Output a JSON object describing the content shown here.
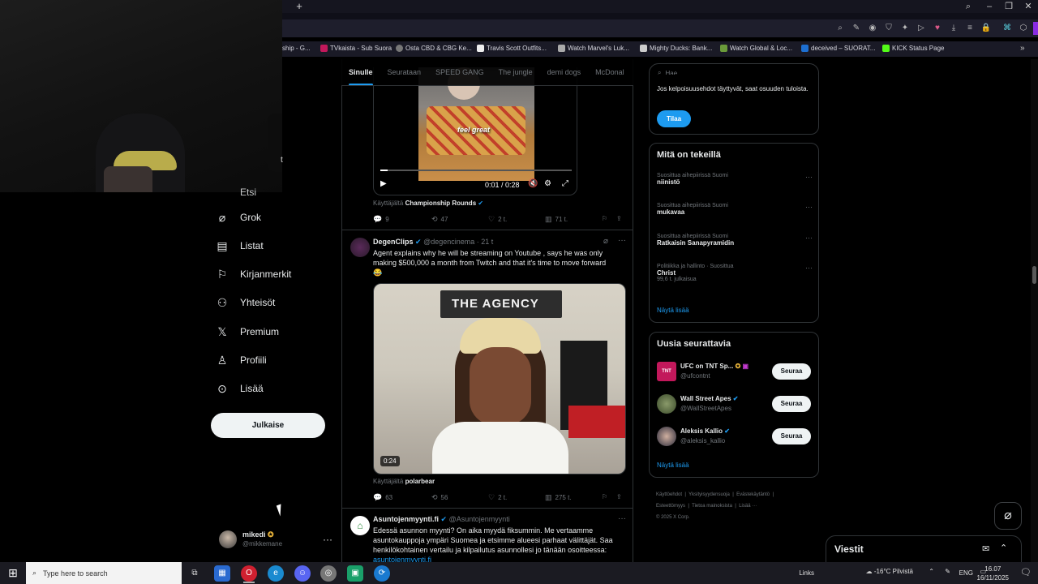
{
  "browser": {
    "bookmarks": [
      "ship - G...",
      "TVkaista - Sub Suora",
      "Osta CBD & CBG Ke...",
      "Travis Scott Outfits...",
      "Watch Marvel's Luk...",
      "Mighty Ducks: Bank...",
      "Watch Global & Loc...",
      "deceived – SUORAT...",
      "KICK Status Page"
    ],
    "colors": {
      "chrome": "#1e1e2c",
      "accent": "#8a2be2"
    }
  },
  "webcam": {
    "label": "t"
  },
  "nav": {
    "partial_item": "Etsi",
    "items": [
      {
        "label": "Grok",
        "icon": "grok-icon"
      },
      {
        "label": "Listat",
        "icon": "list-icon"
      },
      {
        "label": "Kirjanmerkit",
        "icon": "bookmark-icon"
      },
      {
        "label": "Yhteisöt",
        "icon": "communities-icon"
      },
      {
        "label": "Premium",
        "icon": "x-logo-icon"
      },
      {
        "label": "Profiili",
        "icon": "profile-icon"
      },
      {
        "label": "Lisää",
        "icon": "more-circle-icon"
      }
    ],
    "publish": "Julkaise",
    "user": {
      "name": "mikedi",
      "handle": "@mikkemane"
    }
  },
  "feed": {
    "tabs": [
      "Sinulle",
      "Seurataan",
      "SPEED GANG",
      "The jungle",
      "demi dogs",
      "McDonal"
    ],
    "post1": {
      "video_caption": "feel great",
      "video_time": "0:01 / 0:28",
      "from_prefix": "Käyttäjältä",
      "from_user": "Championship Rounds",
      "replies": "9",
      "reposts": "47",
      "likes": "2 t.",
      "views": "71 t."
    },
    "post2": {
      "name": "DegenClips",
      "handle": "@degencinema",
      "time": "· 21 t",
      "text": "Agent explains why he will be streaming on Youtube , says he was only making $500,000 a month from Twitch and that it's time to move forward",
      "emoji": "😂",
      "video_badge": "0:24",
      "video_sign": "THE AGENCY",
      "from_prefix": "Käyttäjältä",
      "from_user": "polarbear",
      "replies": "63",
      "reposts": "56",
      "likes": "2 t.",
      "views": "275 t."
    },
    "post3": {
      "name": "Asuntojenmyynti.fi",
      "handle": "@Asuntojenmyynti",
      "text": "Edessä asunnon myynti? On aika myydä fiksummin. Me vertaamme asuntokauppoja ympäri Suomea ja etsimme alueesi parhaat välittäjät. Saa henkilökohtainen vertailu ja kilpailutus asunnollesi jo tänään osoitteessa:",
      "link": "asuntojenmyynti.fi"
    }
  },
  "right": {
    "search_placeholder": "Hae",
    "premium_text": "Jos kelpoisuusehdot täyttyvät, saat osuuden tuloista.",
    "subscribe": "Tilaa",
    "trends_title": "Mitä on tekeillä",
    "trends": [
      {
        "category": "Suosittua aihepiirissä Suomi",
        "name": "niinistö",
        "count": ""
      },
      {
        "category": "Suosittua aihepiirissä Suomi",
        "name": "mukavaa",
        "count": ""
      },
      {
        "category": "Suosittua aihepiirissä Suomi",
        "name": "Ratkaisin Sanapyramidin",
        "count": ""
      },
      {
        "category": "Politiikka ja hallinto · Suosittua",
        "name": "Christ",
        "count": "99,6 t. julkaisua"
      }
    ],
    "show_more": "Näytä lisää",
    "follow_title": "Uusia seurattavia",
    "follows": [
      {
        "name": "UFC on TNT Sp...",
        "handle": "@ufcontnt",
        "button": "Seuraa",
        "avatar_color": "#c2185b",
        "avatar_text": "TNT"
      },
      {
        "name": "Wall Street Apes",
        "handle": "@WallStreetApes",
        "button": "Seuraa",
        "avatar_color": "#4a5a3a",
        "avatar_text": ""
      },
      {
        "name": "Aleksis Kallio",
        "handle": "@aleksis_kallio",
        "button": "Seuraa",
        "avatar_color": "#3a3a4a",
        "avatar_text": ""
      }
    ],
    "footer": [
      "Käyttöehdot",
      "Yksityisyydensuoja",
      "Evästekäytäntö",
      "Esteettömyys",
      "Tietoa mainoksista",
      "Lisää ···",
      "© 2025 X Corp."
    ],
    "messages": "Viestit"
  },
  "taskbar": {
    "search_placeholder": "Type here to search",
    "links": "Links",
    "weather": "-16°C Pilvistä",
    "lang": "ENG",
    "time": "16.07",
    "date": "16/11/2025"
  }
}
